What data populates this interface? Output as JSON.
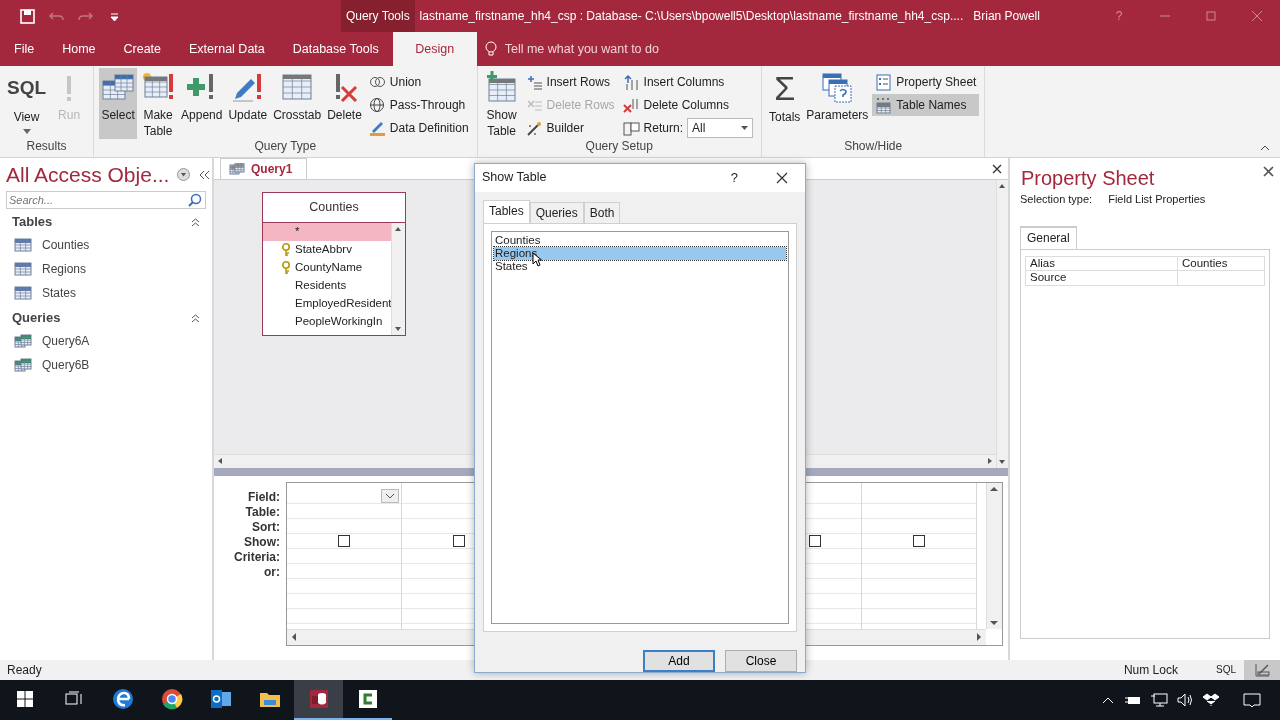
{
  "title_bar": {
    "contextual_label": "Query Tools",
    "title": "lastname_firstname_hh4_csp : Database- C:\\Users\\bpowell5\\Desktop\\lastname_firstname_hh4_csp....",
    "user": "Brian Powell",
    "help_label": "?",
    "quick_access": [
      {
        "disabled": false
      },
      {
        "disabled": true
      },
      {
        "disabled": true
      },
      {
        "disabled": false
      }
    ]
  },
  "ribbon_tabs": [
    {
      "label": "File",
      "selected": false
    },
    {
      "label": "Home",
      "selected": false
    },
    {
      "label": "Create",
      "selected": false
    },
    {
      "label": "External Data",
      "selected": false
    },
    {
      "label": "Database Tools",
      "selected": false
    },
    {
      "label": "Design",
      "selected": true
    }
  ],
  "tell_me": {
    "placeholder": "Tell me what you want to do"
  },
  "ribbon_groups": [
    {
      "label": "Results",
      "buttons": [
        {
          "kind": "large",
          "label": "View",
          "icon_text": "SQL",
          "dropdown": true,
          "disabled": false,
          "on": false
        },
        {
          "kind": "large",
          "label": "Run",
          "disabled": true,
          "on": false
        }
      ]
    },
    {
      "label": "Query Type",
      "buttons": [
        {
          "kind": "large",
          "label": "Select",
          "disabled": false,
          "on": true
        },
        {
          "kind": "large",
          "label": "Make Table",
          "disabled": false,
          "on": false
        },
        {
          "kind": "large",
          "label": "Append",
          "disabled": false,
          "on": false
        },
        {
          "kind": "large",
          "label": "Update",
          "disabled": false,
          "on": false
        },
        {
          "kind": "large",
          "label": "Crosstab",
          "disabled": false,
          "on": false
        },
        {
          "kind": "large",
          "label": "Delete",
          "disabled": false,
          "on": false
        },
        {
          "kind": "small",
          "label": "Union",
          "disabled": false,
          "on": false
        },
        {
          "kind": "small",
          "label": "Pass-Through",
          "disabled": false,
          "on": false
        },
        {
          "kind": "small",
          "label": "Data Definition",
          "disabled": false,
          "on": false
        }
      ]
    },
    {
      "label": "Query Setup",
      "buttons": [
        {
          "kind": "large",
          "label": "Show Table",
          "disabled": false,
          "on": false
        },
        {
          "kind": "small",
          "label": "Insert Rows",
          "disabled": false,
          "on": false
        },
        {
          "kind": "small",
          "label": "Delete Rows",
          "disabled": true,
          "on": false
        },
        {
          "kind": "small",
          "label": "Builder",
          "disabled": false,
          "on": false
        },
        {
          "kind": "small",
          "label": "Insert Columns",
          "disabled": false,
          "on": false
        },
        {
          "kind": "small",
          "label": "Delete Columns",
          "disabled": false,
          "on": false
        },
        {
          "kind": "select",
          "label": "Return:",
          "value": "All",
          "disabled": false,
          "on": false
        }
      ]
    },
    {
      "label": "Show/Hide",
      "buttons": [
        {
          "kind": "large",
          "label": "Totals",
          "icon_text": "Σ",
          "disabled": false,
          "on": false
        },
        {
          "kind": "large",
          "label": "Parameters",
          "disabled": false,
          "on": false
        },
        {
          "kind": "small",
          "label": "Property Sheet",
          "disabled": false,
          "on": false
        },
        {
          "kind": "small",
          "label": "Table Names",
          "disabled": false,
          "on": true
        }
      ]
    }
  ],
  "navigation_pane": {
    "title": "All Access Obje...",
    "search": {
      "placeholder": "Search..."
    },
    "groups": [
      {
        "label": "Tables",
        "kind": "table",
        "expanded": true,
        "items": [
          {
            "label": "Counties",
            "selected": false
          },
          {
            "label": "Regions",
            "selected": false
          },
          {
            "label": "States",
            "selected": false
          }
        ]
      },
      {
        "label": "Queries",
        "kind": "query",
        "expanded": true,
        "items": [
          {
            "label": "Query6A",
            "selected": false
          },
          {
            "label": "Query6B",
            "selected": false
          }
        ]
      }
    ]
  },
  "document_tabs": [
    {
      "label": "Query1",
      "selected": true
    }
  ],
  "field_lists": [
    {
      "title": "Counties",
      "fields": [
        {
          "name": "*",
          "key": false,
          "selected": true
        },
        {
          "name": "StateAbbrv",
          "key": true,
          "selected": false
        },
        {
          "name": "CountyName",
          "key": true,
          "selected": false
        },
        {
          "name": "Residents",
          "key": false,
          "selected": false
        },
        {
          "name": "EmployedResident",
          "key": false,
          "selected": false
        },
        {
          "name": "PeopleWorkingIn",
          "key": false,
          "selected": false
        }
      ]
    }
  ],
  "query_grid": {
    "row_labels": [
      "Field:",
      "Table:",
      "Sort:",
      "Show:",
      "Criteria:",
      "or:"
    ],
    "columns": [
      {
        "show": false,
        "dropdown": true
      },
      {
        "show": false
      },
      {
        "show": false
      },
      {
        "show": false
      }
    ]
  },
  "property_sheet": {
    "title": "Property Sheet",
    "selection_type_label": "Selection type:",
    "selection_type": "Field List Properties",
    "tabs": [
      {
        "label": "General",
        "selected": true
      }
    ],
    "properties": [
      {
        "name": "Alias",
        "value": "Counties"
      },
      {
        "name": "Source"
      }
    ]
  },
  "dialog": {
    "title": "Show Table",
    "help_label": "?",
    "tabs": [
      {
        "label": "Tables",
        "selected": true
      },
      {
        "label": "Queries",
        "selected": false
      },
      {
        "label": "Both",
        "selected": false
      }
    ],
    "items": [
      {
        "label": "Counties",
        "selected": false
      },
      {
        "label": "Regions",
        "selected": true
      },
      {
        "label": "States",
        "selected": false
      }
    ],
    "buttons": [
      {
        "label": "Add",
        "default": true
      },
      {
        "label": "Close",
        "default": false
      }
    ]
  },
  "status_bar": {
    "text": "Ready",
    "indicators": [
      "Num Lock"
    ],
    "views": [
      {
        "kind": "sql",
        "label": "SQL",
        "selected": false
      },
      {
        "kind": "design",
        "selected": true
      }
    ]
  },
  "taskbar": {
    "apps": [
      {
        "running": false,
        "active": false
      },
      {
        "running": false,
        "active": false
      },
      {
        "running": false,
        "active": false
      },
      {
        "running": false,
        "active": false
      },
      {
        "running": true,
        "active": true
      },
      {
        "running": true,
        "active": false
      }
    ]
  }
}
